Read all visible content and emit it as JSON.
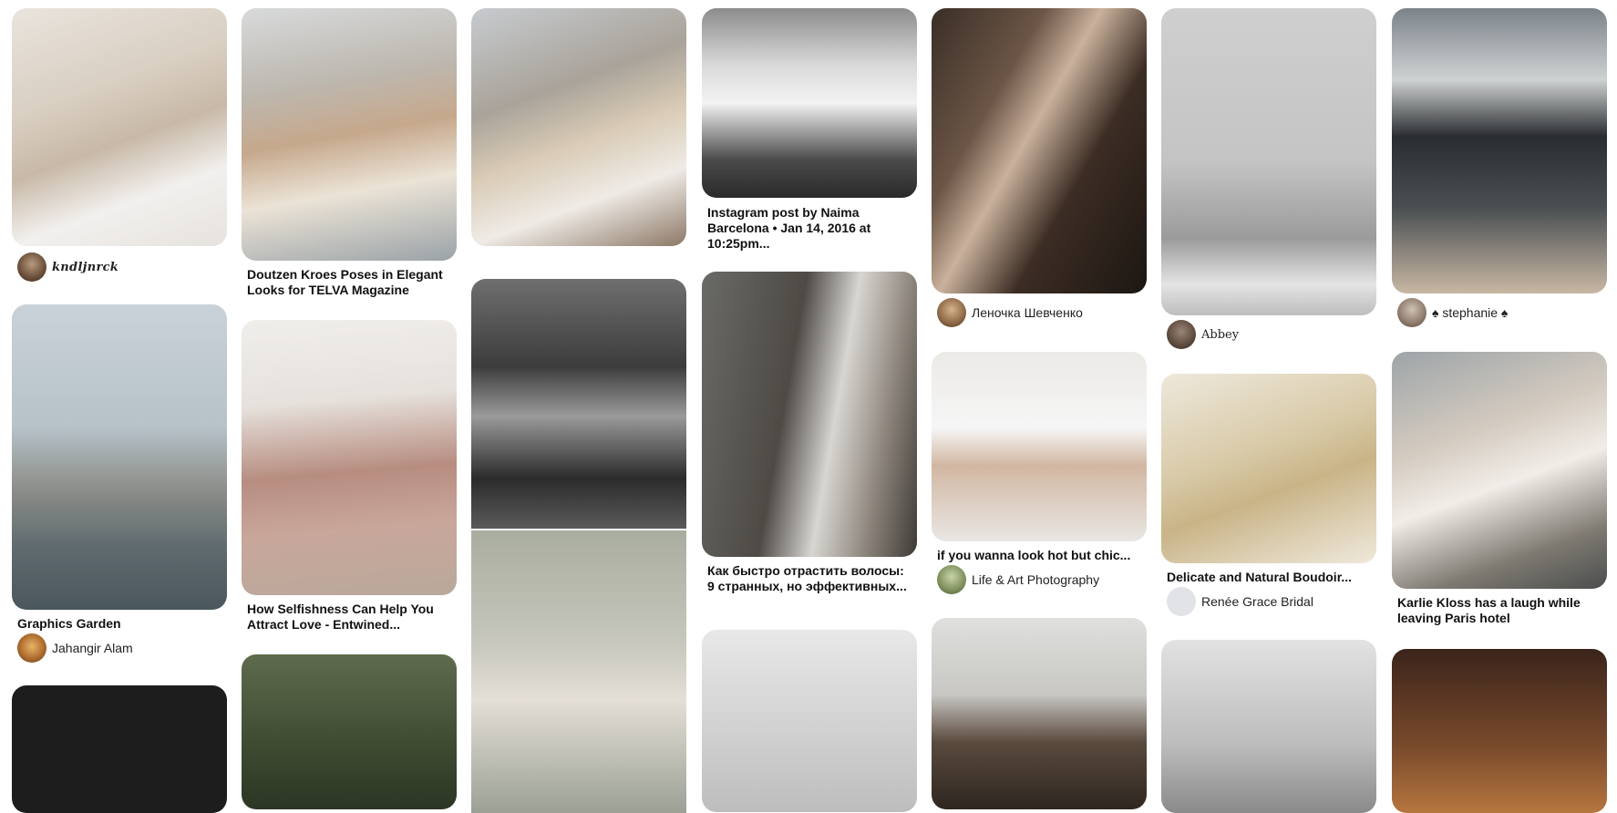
{
  "pins": {
    "p1": {
      "creator": "kndljnrck"
    },
    "p2": {
      "title": "Graphics Garden",
      "creator": "Jahangir Alam"
    },
    "p3": {
      "title": "Doutzen Kroes Poses in Elegant Looks for TELVA Magazine"
    },
    "p4": {
      "title": "How Selfishness Can Help You Attract Love - Entwined..."
    },
    "p5": {
      "title": "Instagram post by Naima Barcelona • Jan 14, 2016 at 10:25pm..."
    },
    "p6": {
      "title": "Как быстро отрастить волосы: 9 странных, но эффективных..."
    },
    "p7": {
      "creator": "Леночка Шевченко"
    },
    "p8": {
      "title": "if you wanna look hot but chic...",
      "creator": "Life & Art Photography"
    },
    "p9": {
      "creator": "Abbey"
    },
    "p10": {
      "title": "Delicate and Natural Boudoir...",
      "creator": "Renée Grace Bridal"
    },
    "p11": {
      "creator": "♠ stephanie ♠"
    },
    "p12": {
      "title": "Karlie Kloss has a laugh while leaving Paris hotel"
    }
  }
}
